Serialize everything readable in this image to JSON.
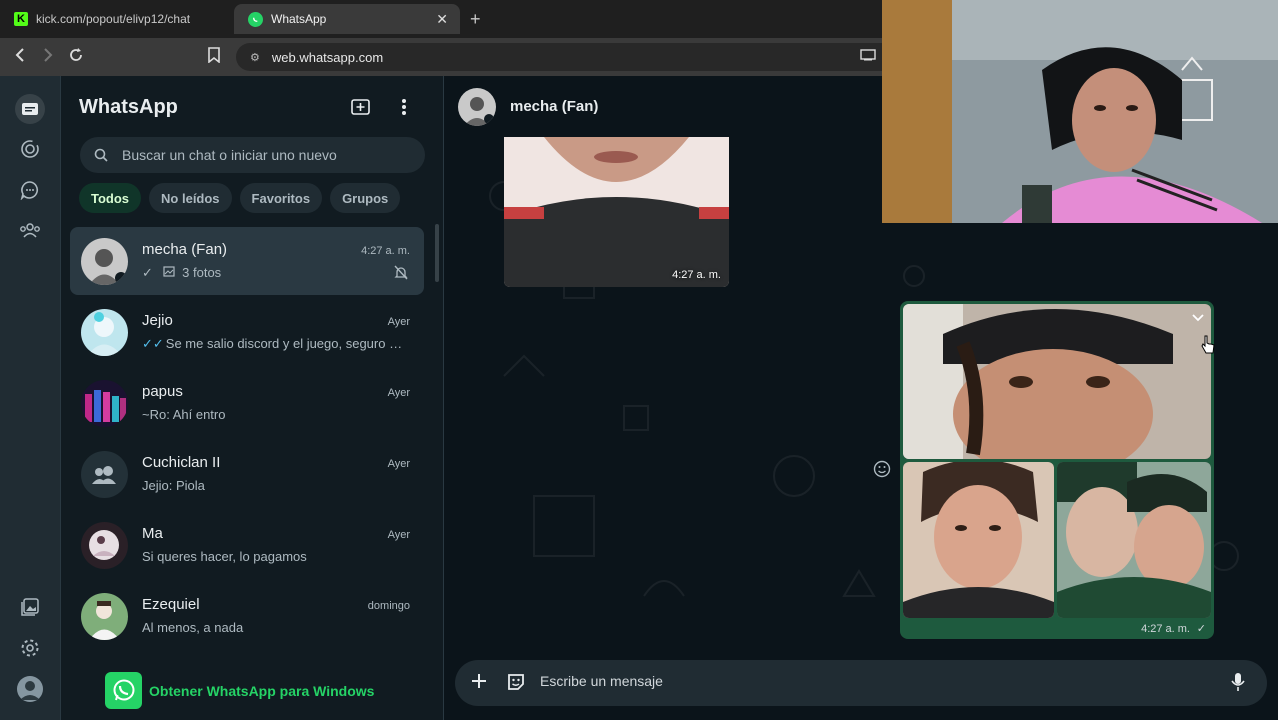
{
  "browser": {
    "tabs": [
      {
        "label": "kick.com/popout/elivp12/chat"
      },
      {
        "label": "WhatsApp"
      }
    ],
    "url": "web.whatsapp.com",
    "kick_letter": "K"
  },
  "sidebar": {
    "title": "WhatsApp",
    "search_placeholder": "Buscar un chat o iniciar uno nuevo",
    "filters": [
      "Todos",
      "No leídos",
      "Favoritos",
      "Grupos"
    ],
    "chats": [
      {
        "name": "mecha (Fan)",
        "time": "4:27 a. m.",
        "preview": "3 fotos"
      },
      {
        "name": "Jejio",
        "time": "Ayer",
        "preview": "Se me salio discord y el juego, seguro se..."
      },
      {
        "name": "papus",
        "time": "Ayer",
        "preview": "~Ro: Ahí entro"
      },
      {
        "name": "Cuchiclan II",
        "time": "Ayer",
        "preview": "Jejio: Piola"
      },
      {
        "name": "Ma",
        "time": "Ayer",
        "preview": "Si queres hacer, lo pagamos"
      },
      {
        "name": "Ezequiel",
        "time": "domingo",
        "preview": "Al menos, a nada"
      }
    ],
    "get_app": "Obtener WhatsApp para Windows"
  },
  "conversation": {
    "contact": "mecha (Fan)",
    "messages": [
      {
        "time": "4:27 a. m."
      },
      {
        "time": "4:27 a. m."
      }
    ],
    "composer_placeholder": "Escribe un mensaje"
  },
  "colors": {
    "accent": "#25d366",
    "sent_bubble": "#1e5a3e",
    "panel": "#111b21"
  }
}
